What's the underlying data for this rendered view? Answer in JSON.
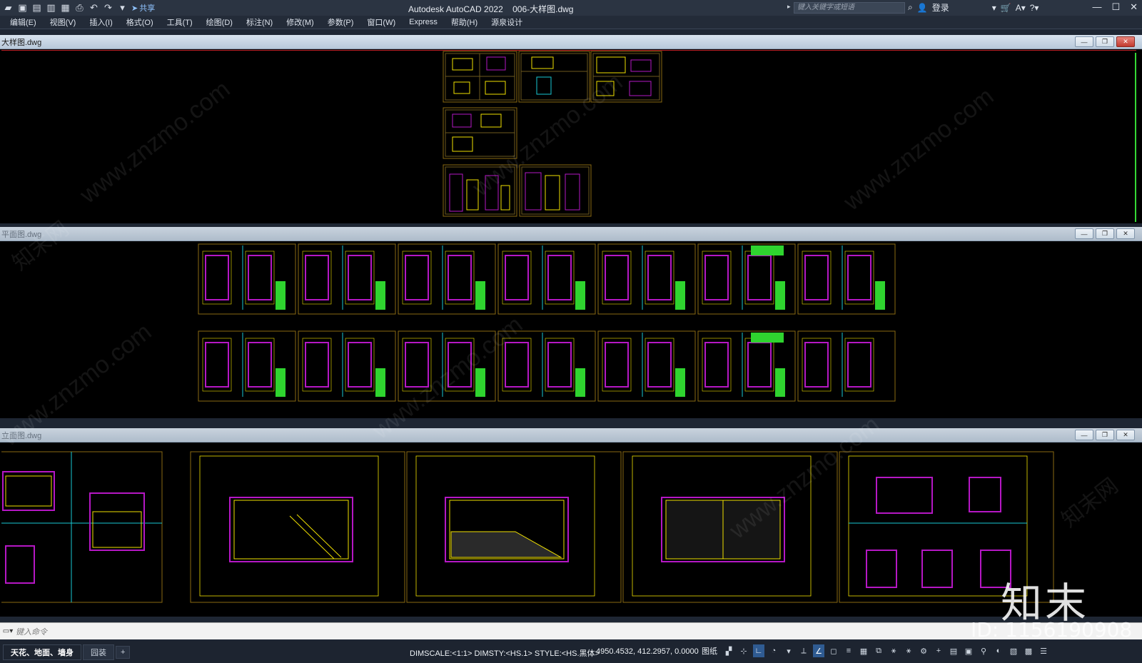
{
  "titlebar": {
    "app_title": "Autodesk AutoCAD 2022",
    "doc_title": "006-大样图.dwg",
    "share_label": "共享",
    "search_placeholder": "键入关键字或短语",
    "login_label": "登录"
  },
  "menubar": {
    "items": [
      "编辑(E)",
      "视图(V)",
      "插入(I)",
      "格式(O)",
      "工具(T)",
      "绘图(D)",
      "标注(N)",
      "修改(M)",
      "参数(P)",
      "窗口(W)",
      "Express",
      "帮助(H)",
      "源泉设计"
    ]
  },
  "documents": [
    {
      "title": "大样图.dwg",
      "active": true
    },
    {
      "title": "平面图.dwg",
      "active": false
    },
    {
      "title": "立面图.dwg",
      "active": false
    }
  ],
  "commandline": {
    "placeholder": "键入命令"
  },
  "statusbar": {
    "layout_tabs": [
      "天花、地面、墙身",
      "园装",
      "+"
    ],
    "dim_info": "DIMSCALE:<1:1> DIMSTY:<HS.1> STYLE:<HS.黑体>",
    "coords": "4950.4532, 412.2957, 0.0000",
    "paper_label": "图纸"
  },
  "watermark": {
    "brand": "知末",
    "id_text": "ID: 1156190908",
    "site": "www.znzmo.com",
    "site_cn": "知末网"
  },
  "colors": {
    "cad_background": "#000000",
    "sheet_frame": "#8a6a12",
    "wall_magenta": "#b517c4",
    "dim_yellow": "#f0e000",
    "table_green": "#2fd42f",
    "cyan_line": "#19c9d3"
  }
}
